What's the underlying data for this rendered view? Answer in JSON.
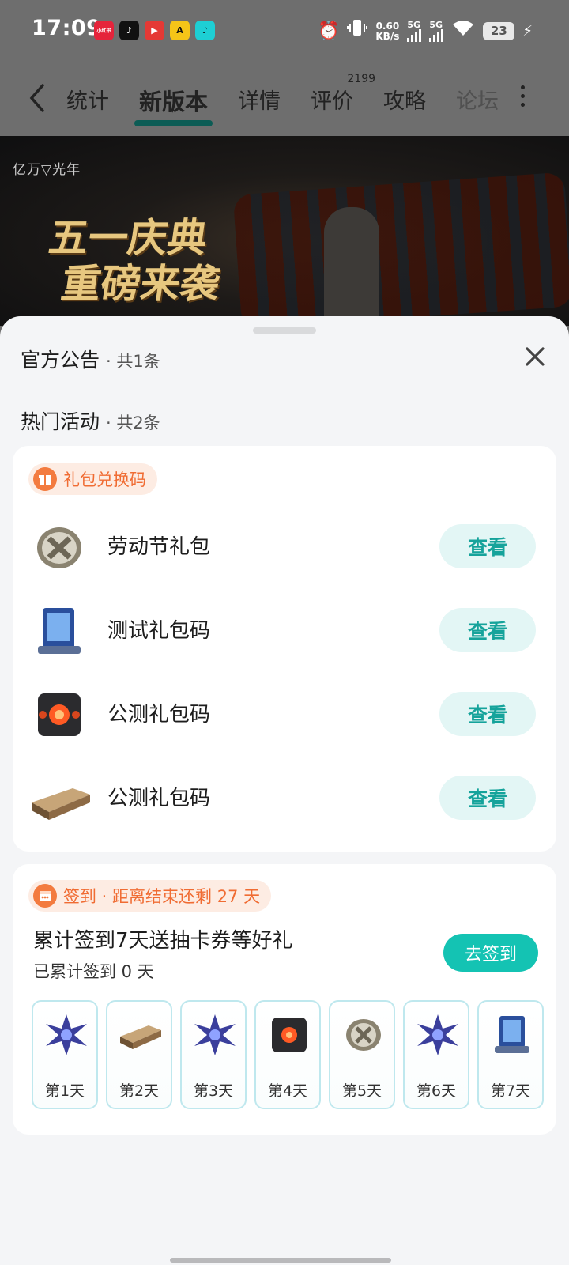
{
  "status_bar": {
    "time": "17:09",
    "app_icons": [
      {
        "name": "xiaohongshu-app-icon",
        "text": "小红书",
        "color": "#e5243b"
      },
      {
        "name": "tiktok-app-icon",
        "text": "♪",
        "color": "#111111"
      },
      {
        "name": "video-app-icon",
        "text": "▶",
        "color": "#e53935"
      },
      {
        "name": "yellow-app-icon",
        "text": "A",
        "color": "#f5c518"
      },
      {
        "name": "tiktok-lite-app-icon",
        "text": "♪",
        "color": "#1ecfd4"
      }
    ],
    "net_speed_value": "0.60",
    "net_speed_unit": "KB/s",
    "signal_1_label": "5G",
    "signal_2_label": "5G",
    "battery": "23"
  },
  "nav": {
    "tabs": [
      {
        "label": "统计"
      },
      {
        "label": "新版本"
      },
      {
        "label": "详情"
      },
      {
        "label": "评价",
        "badge": "2199"
      },
      {
        "label": "攻略"
      },
      {
        "label": "论坛"
      }
    ]
  },
  "banner": {
    "logo": "亿万▽光年",
    "title_line1": "五一庆典",
    "title_line2": "重磅来袭"
  },
  "sheet": {
    "announcements": {
      "label": "官方公告",
      "count": "· 共1条"
    },
    "activities": {
      "label": "热门活动",
      "count": "· 共2条"
    },
    "gift_card": {
      "pill": "礼包兑换码",
      "view_label": "查看",
      "items": [
        {
          "name": "劳动节礼包",
          "icon": "x-coin-icon"
        },
        {
          "name": "测试礼包码",
          "icon": "blue-capsule-icon"
        },
        {
          "name": "公测礼包码",
          "icon": "red-core-cube-icon"
        },
        {
          "name": "公测礼包码",
          "icon": "ore-bar-icon"
        }
      ]
    },
    "signin_card": {
      "pill": "签到 · 距离结束还剩 27 天",
      "title": "累计签到7天送抽卡券等好礼",
      "progress": "已累计签到 0 天",
      "button": "去签到",
      "days": [
        {
          "label": "第1天",
          "icon": "purple-crystal-icon"
        },
        {
          "label": "第2天",
          "icon": "ore-bar-icon"
        },
        {
          "label": "第3天",
          "icon": "purple-crystal-icon"
        },
        {
          "label": "第4天",
          "icon": "red-core-cube-icon"
        },
        {
          "label": "第5天",
          "icon": "x-coin-icon"
        },
        {
          "label": "第6天",
          "icon": "purple-crystal-icon"
        },
        {
          "label": "第7天",
          "icon": "blue-capsule-icon"
        }
      ]
    }
  }
}
